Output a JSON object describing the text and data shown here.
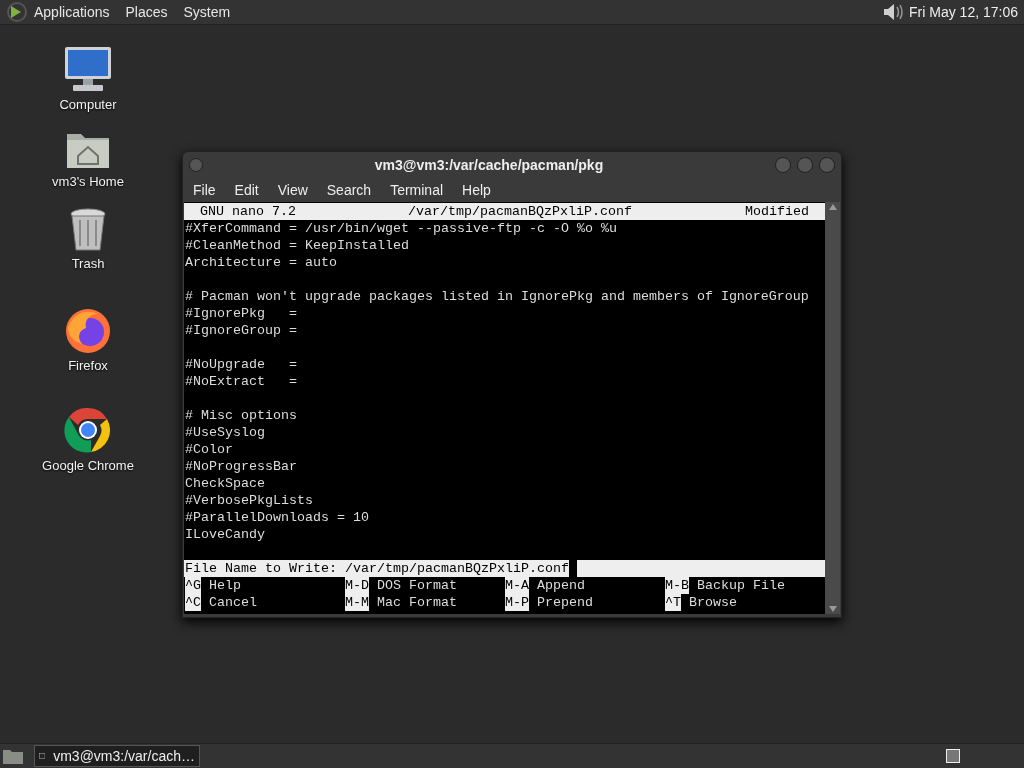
{
  "top_panel": {
    "menus": [
      "Applications",
      "Places",
      "System"
    ],
    "clock": "Fri May 12, 17:06"
  },
  "desktop_icons": [
    {
      "label": "Computer",
      "kind": "computer"
    },
    {
      "label": "vm3's Home",
      "kind": "home"
    },
    {
      "label": "Trash",
      "kind": "trash"
    },
    {
      "label": "Firefox",
      "kind": "firefox"
    },
    {
      "label": "Google Chrome",
      "kind": "chrome"
    }
  ],
  "terminal_window": {
    "title": "vm3@vm3:/var/cache/pacman/pkg",
    "menu": [
      "File",
      "Edit",
      "View",
      "Search",
      "Terminal",
      "Help"
    ],
    "nano": {
      "header": {
        "version": "GNU nano 7.2",
        "file": "/var/tmp/pacmanBQzPxliP.conf",
        "status": "Modified"
      },
      "blocks": [
        [
          "#XferCommand = /usr/bin/wget --passive-ftp -c -O %o %u",
          "#CleanMethod = KeepInstalled",
          "Architecture = auto"
        ],
        [
          "# Pacman won't upgrade packages listed in IgnorePkg and members of IgnoreGroup",
          "#IgnorePkg   =",
          "#IgnoreGroup ="
        ],
        [
          "#NoUpgrade   =",
          "#NoExtract   ="
        ],
        [
          "# Misc options",
          "#UseSyslog",
          "#Color",
          "#NoProgressBar",
          "CheckSpace",
          "#VerbosePkgLists",
          "#ParallelDownloads = 10",
          "ILoveCandy"
        ]
      ],
      "prompt": {
        "label": "File Name to Write:",
        "value": "/var/tmp/pacmanBQzPxliP.conf"
      },
      "shortcuts": [
        {
          "key": "^G",
          "label": "Help"
        },
        {
          "key": "M-D",
          "label": "DOS Format"
        },
        {
          "key": "M-A",
          "label": "Append"
        },
        {
          "key": "M-B",
          "label": "Backup File"
        },
        {
          "key": "^C",
          "label": "Cancel"
        },
        {
          "key": "M-M",
          "label": "Mac Format"
        },
        {
          "key": "M-P",
          "label": "Prepend"
        },
        {
          "key": "^T",
          "label": "Browse"
        }
      ]
    }
  },
  "taskbar": {
    "tasks": [
      {
        "label": "vm3@vm3:/var/cach…"
      }
    ]
  }
}
